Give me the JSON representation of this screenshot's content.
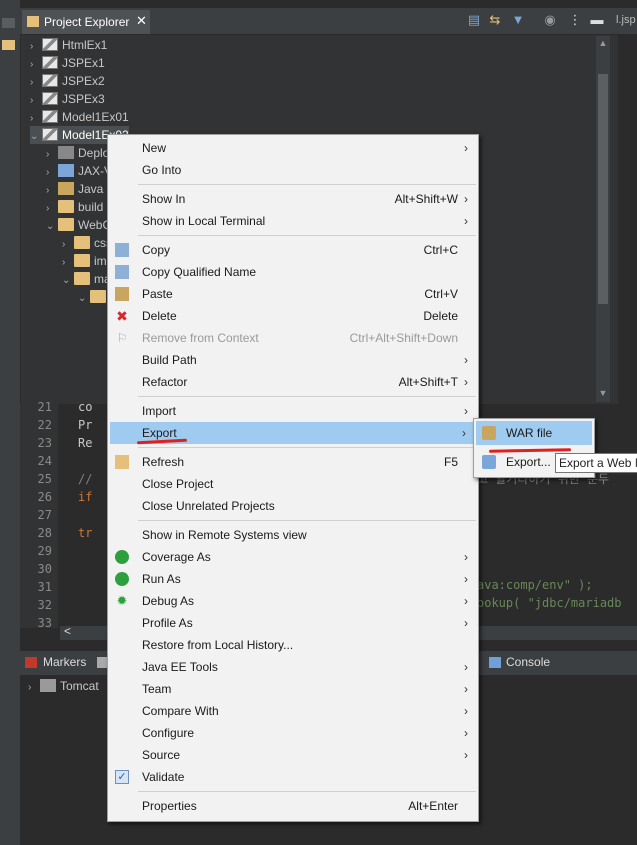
{
  "left_strip": {
    "icons": [
      "pin-icon",
      "package-explorer-icon"
    ]
  },
  "project_explorer": {
    "tab_label": "Project Explorer",
    "close_glyph": "✕",
    "toolbar_icons": [
      "collapse-all-icon",
      "link-with-editor-icon",
      "filter-icon",
      "focus-icon",
      "view-menu-icon",
      "minimize-icon"
    ],
    "editor_tab_edge_label": "l.jsp",
    "tree": [
      {
        "label": "HtmlEx1",
        "arrow": "›",
        "icon": "web-project-icon"
      },
      {
        "label": "JSPEx1",
        "arrow": "›",
        "icon": "web-project-icon"
      },
      {
        "label": "JSPEx2",
        "arrow": "›",
        "icon": "web-project-icon"
      },
      {
        "label": "JSPEx3",
        "arrow": "›",
        "icon": "web-project-icon"
      },
      {
        "label": "Model1Ex01",
        "arrow": "›",
        "icon": "web-project-icon"
      },
      {
        "label": "Model1Ex02",
        "arrow": "⌄",
        "icon": "web-project-icon"
      },
      {
        "label": "Deplo",
        "arrow": "›",
        "icon": "deployment-icon"
      },
      {
        "label": "JAX-V",
        "arrow": "›",
        "icon": "jaxws-icon"
      },
      {
        "label": "Java R",
        "arrow": "›",
        "icon": "java-resources-icon"
      },
      {
        "label": "build",
        "arrow": "›",
        "icon": "folder-icon"
      },
      {
        "label": "WebC",
        "arrow": "⌄",
        "icon": "folder-icon"
      },
      {
        "label": "css",
        "arrow": "›",
        "icon": "folder-icon"
      },
      {
        "label": "im",
        "arrow": "›",
        "icon": "folder-icon"
      },
      {
        "label": "ma",
        "arrow": "⌄",
        "icon": "folder-icon"
      },
      {
        "label": "",
        "arrow": "⌄",
        "icon": "folder-icon"
      }
    ]
  },
  "editor": {
    "line_numbers": [
      "21",
      "22",
      "23",
      "24",
      "25",
      "26",
      "27",
      "28",
      "29",
      "30",
      "31",
      "32",
      "33"
    ],
    "code_lines": [
      {
        "text": "  co",
        "color": "#c8c8c8"
      },
      {
        "text": "  Pr",
        "color": "#c8c8c8"
      },
      {
        "text": "  Re",
        "color": "#c8c8c8"
      },
      {
        "text": "",
        "color": "#c8c8c8"
      },
      {
        "text": "  //",
        "color": "#808080"
      },
      {
        "text": "  if",
        "color": "#cc7832"
      },
      {
        "text": "",
        "color": "#c8c8c8"
      },
      {
        "text": "  tr",
        "color": "#cc7832"
      },
      {
        "text": "",
        "color": "#c8c8c8"
      },
      {
        "text": "",
        "color": "#c8c8c8"
      },
      {
        "text": "",
        "color": "#c8c8c8"
      },
      {
        "text": "",
        "color": "#c8c8c8"
      },
      {
        "text": "",
        "color": "#c8c8c8"
      }
    ],
    "visible_right_fragments": [
      {
        "text": "고 할거라하기 위한 분두",
        "color": "#808080"
      },
      {
        "text": "ava:comp/env\" );",
        "color": "#6a8759"
      },
      {
        "text": "ookup( \"jdbc/mariadb",
        "color": "#6a8759"
      }
    ],
    "hscroll_glyph": "<"
  },
  "bottom": {
    "markers_tab": "Markers",
    "console_tab": "Console",
    "server_item": "Tomcat"
  },
  "context_menu": {
    "items": [
      {
        "label": "New",
        "accel": "",
        "submenu": true,
        "icon": "",
        "disabled": false
      },
      {
        "label": "Go Into",
        "accel": "",
        "submenu": false,
        "icon": "",
        "disabled": false
      },
      {
        "sep": true
      },
      {
        "label": "Show In",
        "accel": "Alt+Shift+W",
        "submenu": true,
        "icon": "",
        "disabled": false
      },
      {
        "label": "Show in Local Terminal",
        "accel": "",
        "submenu": true,
        "icon": "",
        "disabled": false
      },
      {
        "sep": true
      },
      {
        "label": "Copy",
        "accel": "Ctrl+C",
        "submenu": false,
        "icon": "copy-icon",
        "disabled": false
      },
      {
        "label": "Copy Qualified Name",
        "accel": "",
        "submenu": false,
        "icon": "copy-qualified-icon",
        "disabled": false
      },
      {
        "label": "Paste",
        "accel": "Ctrl+V",
        "submenu": false,
        "icon": "paste-icon",
        "disabled": false
      },
      {
        "label": "Delete",
        "accel": "Delete",
        "submenu": false,
        "icon": "delete-icon",
        "disabled": false
      },
      {
        "label": "Remove from Context",
        "accel": "Ctrl+Alt+Shift+Down",
        "submenu": false,
        "icon": "remove-context-icon",
        "disabled": true
      },
      {
        "label": "Build Path",
        "accel": "",
        "submenu": true,
        "icon": "",
        "disabled": false
      },
      {
        "label": "Refactor",
        "accel": "Alt+Shift+T",
        "submenu": true,
        "icon": "",
        "disabled": false
      },
      {
        "sep": true
      },
      {
        "label": "Import",
        "accel": "",
        "submenu": true,
        "icon": "",
        "disabled": false
      },
      {
        "label": "Export",
        "accel": "",
        "submenu": true,
        "icon": "",
        "disabled": false,
        "highlighted": true
      },
      {
        "sep": true
      },
      {
        "label": "Refresh",
        "accel": "F5",
        "submenu": false,
        "icon": "refresh-icon",
        "disabled": false
      },
      {
        "label": "Close Project",
        "accel": "",
        "submenu": false,
        "icon": "",
        "disabled": false
      },
      {
        "label": "Close Unrelated Projects",
        "accel": "",
        "submenu": false,
        "icon": "",
        "disabled": false
      },
      {
        "sep": true
      },
      {
        "label": "Show in Remote Systems view",
        "accel": "",
        "submenu": false,
        "icon": "",
        "disabled": false
      },
      {
        "label": "Coverage As",
        "accel": "",
        "submenu": true,
        "icon": "coverage-icon",
        "disabled": false
      },
      {
        "label": "Run As",
        "accel": "",
        "submenu": true,
        "icon": "run-icon",
        "disabled": false
      },
      {
        "label": "Debug As",
        "accel": "",
        "submenu": true,
        "icon": "debug-icon",
        "disabled": false
      },
      {
        "label": "Profile As",
        "accel": "",
        "submenu": true,
        "icon": "",
        "disabled": false
      },
      {
        "label": "Restore from Local History...",
        "accel": "",
        "submenu": false,
        "icon": "",
        "disabled": false
      },
      {
        "label": "Java EE Tools",
        "accel": "",
        "submenu": true,
        "icon": "",
        "disabled": false
      },
      {
        "label": "Team",
        "accel": "",
        "submenu": true,
        "icon": "",
        "disabled": false
      },
      {
        "label": "Compare With",
        "accel": "",
        "submenu": true,
        "icon": "",
        "disabled": false
      },
      {
        "label": "Configure",
        "accel": "",
        "submenu": true,
        "icon": "",
        "disabled": false
      },
      {
        "label": "Source",
        "accel": "",
        "submenu": true,
        "icon": "",
        "disabled": false
      },
      {
        "label": "Validate",
        "accel": "",
        "submenu": false,
        "icon": "check-icon",
        "disabled": false
      },
      {
        "sep": true
      },
      {
        "label": "Properties",
        "accel": "Alt+Enter",
        "submenu": false,
        "icon": "",
        "disabled": false
      }
    ],
    "submenu_glyph": "›"
  },
  "export_submenu": {
    "items": [
      {
        "label": "WAR file",
        "icon": "war-file-icon",
        "highlighted": true
      },
      {
        "label": "Export...",
        "icon": "export-icon",
        "highlighted": false
      }
    ]
  },
  "tooltip": {
    "text": "Export a Web M"
  },
  "colors": {
    "menu_highlight": "#9fcbf0",
    "annotation_red": "#e0201e",
    "ide_bg": "#2b2b2b"
  }
}
